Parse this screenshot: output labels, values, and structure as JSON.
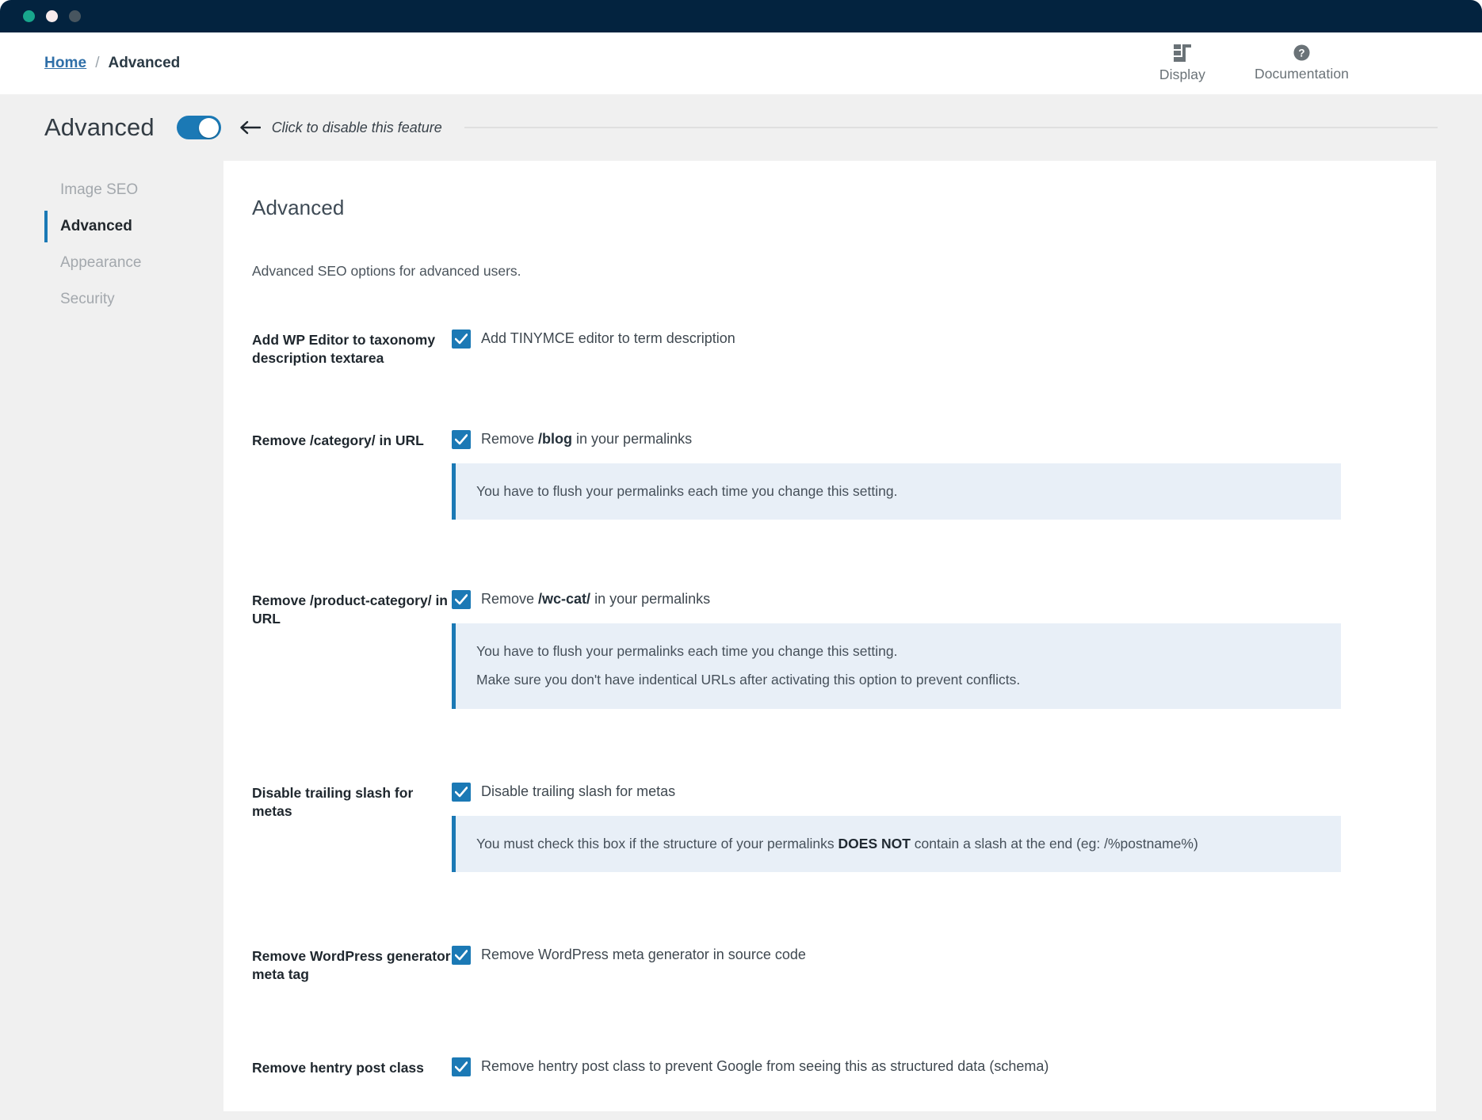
{
  "window": {
    "dots": [
      {
        "name": "close-dot",
        "color": "#18a68c"
      },
      {
        "name": "minimize-dot",
        "color": "#f7ebec"
      },
      {
        "name": "maximize-dot",
        "color": "#47555f"
      }
    ],
    "titlebar_color": "#03233f"
  },
  "breadcrumb": {
    "home": "Home",
    "separator": "/",
    "current": "Advanced"
  },
  "topbar": {
    "actions": [
      {
        "icon": "display-layout-icon",
        "label": "Display"
      },
      {
        "icon": "question-mark-circle-icon",
        "label": "Documentation"
      }
    ]
  },
  "feature_header": {
    "title": "Advanced",
    "toggle_state": "on",
    "arrow_icon": "arrow-left-icon",
    "hint": "Click to disable this feature"
  },
  "sidebar": {
    "items": [
      {
        "label": "Image SEO",
        "active": false
      },
      {
        "label": "Advanced",
        "active": true
      },
      {
        "label": "Appearance",
        "active": false
      },
      {
        "label": "Security",
        "active": false
      }
    ]
  },
  "main": {
    "title": "Advanced",
    "description": "Advanced SEO options for advanced users.",
    "settings": [
      {
        "label": "Add WP Editor to taxonomy description textarea",
        "checkbox_checked": true,
        "checkbox_text_plain": "Add TINYMCE editor to term description",
        "checkbox_text_pre": "Add TINYMCE editor to term description",
        "checkbox_text_bold": "",
        "checkbox_text_post": "",
        "notices": []
      },
      {
        "label": "Remove /category/ in URL",
        "checkbox_checked": true,
        "checkbox_text_plain": "Remove /blog in your permalinks",
        "checkbox_text_pre": "Remove ",
        "checkbox_text_bold": "/blog",
        "checkbox_text_post": " in your permalinks",
        "notices": [
          "You have to flush your permalinks each time you change this setting."
        ]
      },
      {
        "label": "Remove /product-category/ in URL",
        "checkbox_checked": true,
        "checkbox_text_plain": "Remove /wc-cat/ in your permalinks",
        "checkbox_text_pre": "Remove ",
        "checkbox_text_bold": "/wc-cat/",
        "checkbox_text_post": " in your permalinks",
        "notices": [
          "You have to flush your permalinks each time you change this setting.",
          "Make sure you don't have indentical URLs after activating this option to prevent conflicts."
        ]
      },
      {
        "label": "Disable trailing slash for metas",
        "checkbox_checked": true,
        "checkbox_text_plain": "Disable trailing slash for metas",
        "checkbox_text_pre": "Disable trailing slash for metas",
        "checkbox_text_bold": "",
        "checkbox_text_post": "",
        "notices": [
          "You must check this box if the structure of your permalinks DOES NOT contain a slash at the end (eg: /%postname%)"
        ],
        "notice_pre": "You must check this box if the structure of your permalinks ",
        "notice_bold": "DOES NOT",
        "notice_post": " contain a slash at the end (eg: /%postname%)"
      },
      {
        "label": "Remove WordPress generator meta tag",
        "checkbox_checked": true,
        "checkbox_text_plain": "Remove WordPress meta generator in source code",
        "checkbox_text_pre": "Remove WordPress meta generator in source code",
        "checkbox_text_bold": "",
        "checkbox_text_post": "",
        "notices": []
      },
      {
        "label": "Remove hentry post class",
        "checkbox_checked": true,
        "checkbox_text_plain": "Remove hentry post class to prevent Google from seeing this as structured data (schema)",
        "checkbox_text_pre": "Remove hentry post class to prevent Google from seeing this as structured data (schema)",
        "checkbox_text_bold": "",
        "checkbox_text_post": "",
        "notices": []
      }
    ]
  },
  "colors": {
    "accent": "#1b79b5",
    "titlebar": "#03233f",
    "notice_bg": "#e8eff7",
    "page_bg": "#f0f0f0"
  }
}
